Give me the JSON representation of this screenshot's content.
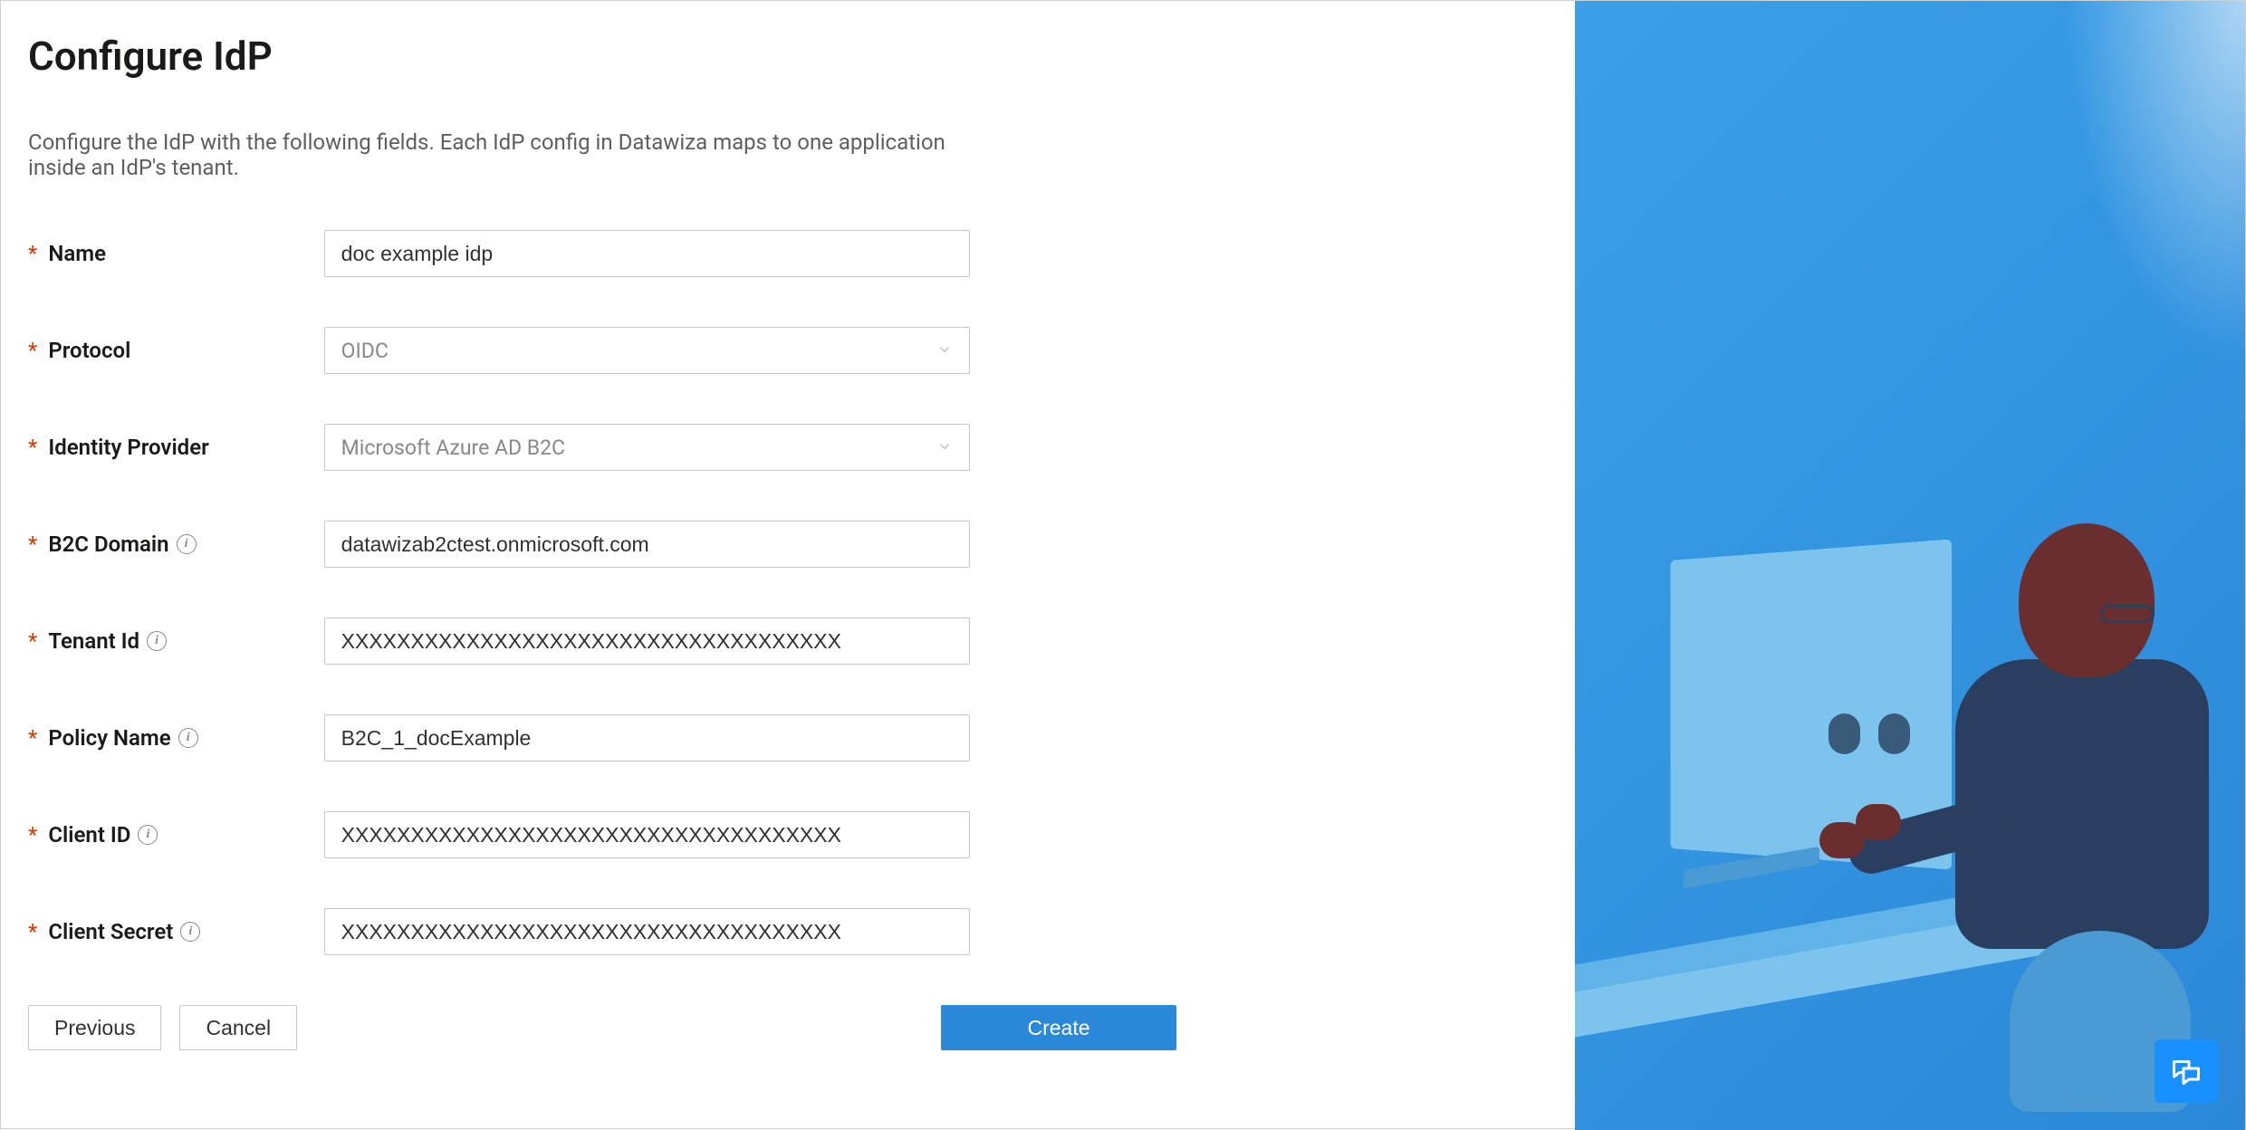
{
  "header": {
    "title": "Configure IdP",
    "description": "Configure the IdP with the following fields. Each IdP config in Datawiza maps to one application inside an IdP's tenant."
  },
  "form": {
    "name": {
      "label": "Name",
      "value": "doc example idp"
    },
    "protocol": {
      "label": "Protocol",
      "value": "OIDC"
    },
    "identity_provider": {
      "label": "Identity Provider",
      "value": "Microsoft Azure AD B2C"
    },
    "b2c_domain": {
      "label": "B2C Domain",
      "value": "datawizab2ctest.onmicrosoft.com"
    },
    "tenant_id": {
      "label": "Tenant Id",
      "value": "XXXXXXXXXXXXXXXXXXXXXXXXXXXXXXXXXXXX"
    },
    "policy_name": {
      "label": "Policy Name",
      "value": "B2C_1_docExample"
    },
    "client_id": {
      "label": "Client ID",
      "value": "XXXXXXXXXXXXXXXXXXXXXXXXXXXXXXXXXXXX"
    },
    "client_secret": {
      "label": "Client Secret",
      "value": "XXXXXXXXXXXXXXXXXXXXXXXXXXXXXXXXXXXX"
    }
  },
  "buttons": {
    "previous": "Previous",
    "cancel": "Cancel",
    "create": "Create"
  }
}
